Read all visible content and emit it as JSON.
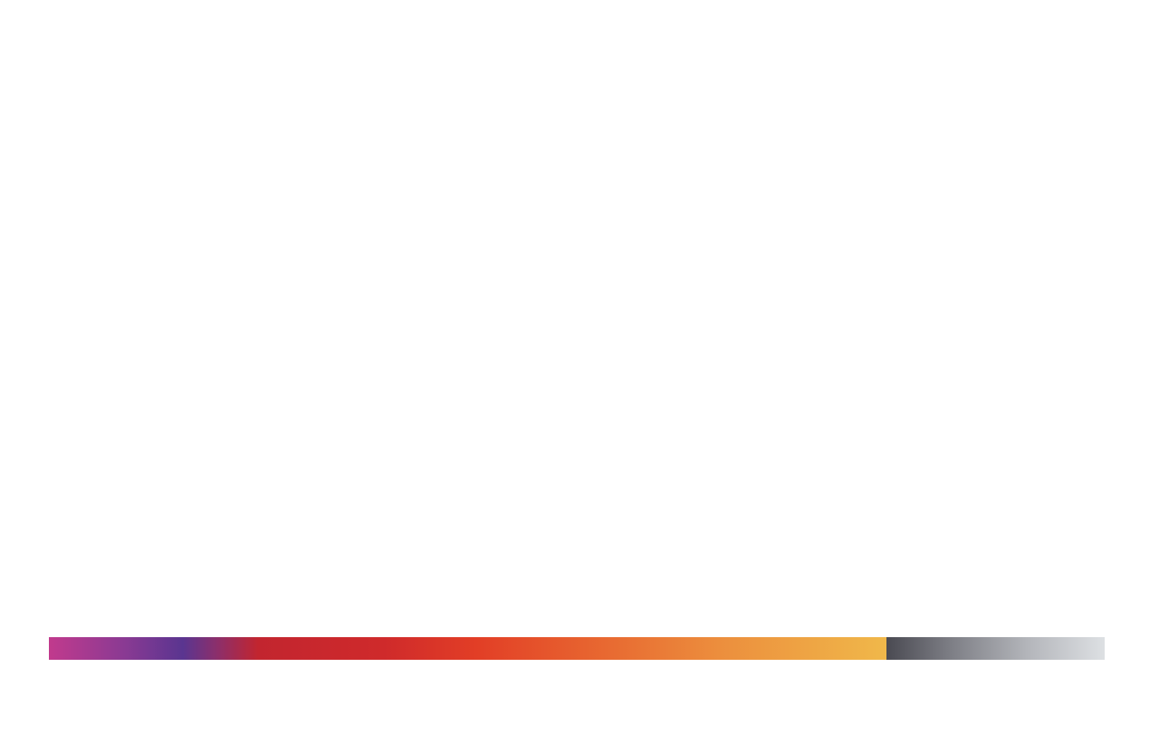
{
  "decor": {
    "stripe": {
      "color_stops": [
        "#c13a8d",
        "#5a3590",
        "#c2252f",
        "#e23e26",
        "#ec8e3d",
        "#f0b84a"
      ],
      "gray_stops": [
        "#4a4a52",
        "#dde0e3"
      ]
    }
  }
}
